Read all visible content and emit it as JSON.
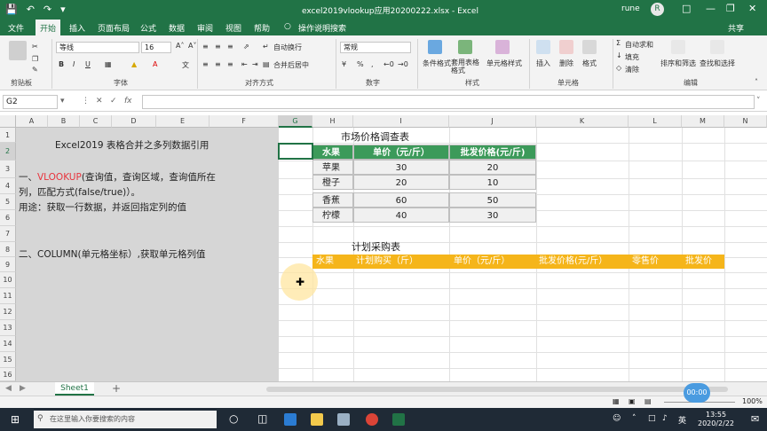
{
  "window": {
    "title": "excel2019vlookup应用20200222.xlsx - Excel",
    "user": "rune",
    "avatar": "R"
  },
  "ribbon_tabs": [
    "文件",
    "开始",
    "插入",
    "页面布局",
    "公式",
    "数据",
    "审阅",
    "视图",
    "帮助",
    "操作说明搜索"
  ],
  "share_label": "共享",
  "ribbon": {
    "font_name": "等线",
    "font_size": "16",
    "wrap_label": "自动换行",
    "merge_label": "合并后居中",
    "number_format": "常规",
    "cond_format": "条件格式",
    "table_format": "套用表格格式",
    "cell_style": "单元格样式",
    "insert": "插入",
    "delete": "删除",
    "format": "格式",
    "autosum": "自动求和",
    "fill": "填充",
    "clear": "清除",
    "sort_filter": "排序和筛选",
    "find_select": "查找和选择",
    "groups": [
      "剪贴板",
      "字体",
      "对齐方式",
      "数字",
      "样式",
      "单元格",
      "编辑"
    ]
  },
  "formula_bar": {
    "name_box": "G2",
    "fx": "fx"
  },
  "columns": [
    "A",
    "B",
    "C",
    "D",
    "E",
    "F",
    "G",
    "H",
    "I",
    "J",
    "K",
    "L",
    "M",
    "N"
  ],
  "rows": [
    "1",
    "2",
    "3",
    "4",
    "5",
    "6",
    "7",
    "8",
    "9",
    "10",
    "11",
    "12",
    "13",
    "14",
    "15",
    "16"
  ],
  "notes": {
    "heading": "Excel2019 表格合并之多列数据引用",
    "line1_prefix": "一、",
    "line1_func": "VLOOKUP",
    "line1_rest": "(查询值，查询区域，查询值所在",
    "line2": "列，匹配方式(false/true)）。",
    "line3": "用途：获取一行数据，并返回指定列的值",
    "line4": "二、COLUMN(单元格坐标）,获取单元格列值"
  },
  "market_table": {
    "title": "市场价格调查表",
    "headers": [
      "水果",
      "单价（元/斤）",
      "批发价格(元/斤)"
    ],
    "rows": [
      [
        "苹果",
        "30",
        "20"
      ],
      [
        "橙子",
        "20",
        "10"
      ],
      [
        "香蕉",
        "60",
        "50"
      ],
      [
        "柠檬",
        "40",
        "30"
      ]
    ]
  },
  "purchase_table": {
    "title": "计划采购表",
    "headers": [
      "水果",
      "计划购买（斤）",
      "单价（元/斤）",
      "批发价格(元/斤）",
      "零售价",
      "批发价"
    ]
  },
  "sheet_tab": "Sheet1",
  "add_sheet": "+",
  "status": {
    "zoom": "100%",
    "badge": "00:00"
  },
  "taskbar": {
    "search_placeholder": "在这里输入你要搜索的内容",
    "lang": "英",
    "time": "13:55",
    "date": "2020/2/22"
  }
}
